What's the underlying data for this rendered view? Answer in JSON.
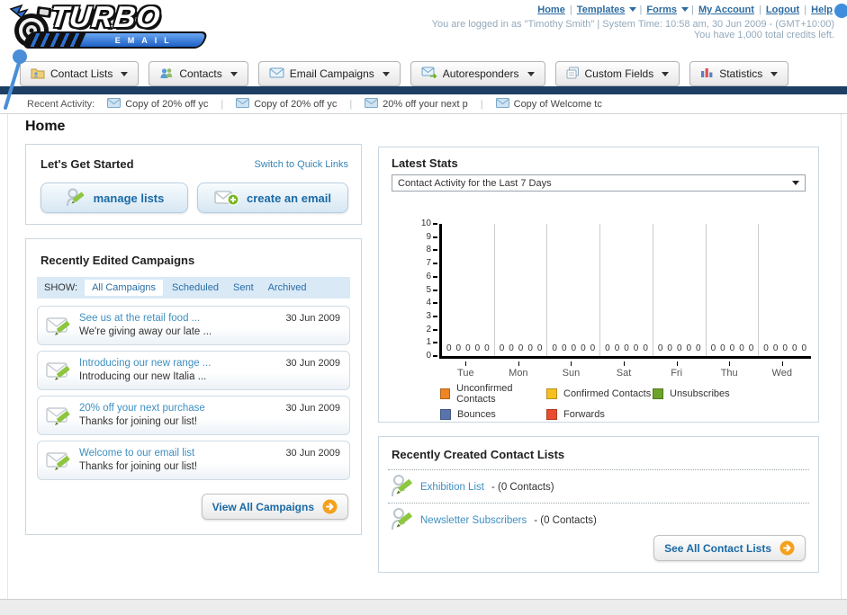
{
  "logo": {
    "title": "TURBO",
    "subtitle": "EMAIL"
  },
  "header": {
    "links": [
      {
        "label": "Home",
        "dropdown": false
      },
      {
        "label": "Templates",
        "dropdown": true
      },
      {
        "label": "Forms",
        "dropdown": true
      },
      {
        "label": "My Account",
        "dropdown": false
      },
      {
        "label": "Logout",
        "dropdown": false
      },
      {
        "label": "Help",
        "dropdown": false
      }
    ],
    "status_line1": "You are logged in as \"Timothy Smith\" | System Time: 10:58 am, 30 Jun 2009 - (GMT+10:00)",
    "status_line2": "You have 1,000 total credits left."
  },
  "nav_tabs": [
    {
      "label": "Contact Lists",
      "icon": "contact-lists-icon"
    },
    {
      "label": "Contacts",
      "icon": "contacts-icon"
    },
    {
      "label": "Email Campaigns",
      "icon": "email-campaigns-icon"
    },
    {
      "label": "Autoresponders",
      "icon": "autoresponders-icon"
    },
    {
      "label": "Custom Fields",
      "icon": "custom-fields-icon"
    },
    {
      "label": "Statistics",
      "icon": "statistics-icon"
    }
  ],
  "recent_activity": {
    "label": "Recent Activity:",
    "items": [
      "Copy of 20% off yc",
      "Copy of 20% off yc",
      "20% off your next p",
      "Copy of Welcome tc"
    ]
  },
  "page_title": "Home",
  "get_started": {
    "title": "Let's Get Started",
    "switch_link": "Switch to Quick Links",
    "buttons": [
      {
        "label": "manage lists",
        "icon": "person-pencil-icon"
      },
      {
        "label": "create an email",
        "icon": "envelope-plus-icon"
      }
    ]
  },
  "campaigns": {
    "title": "Recently Edited Campaigns",
    "show_label": "SHOW:",
    "filters": [
      "All Campaigns",
      "Scheduled",
      "Sent",
      "Archived"
    ],
    "active_filter": "All Campaigns",
    "items": [
      {
        "title": "See us at the retail food ...",
        "subtitle": "We're giving away our late ...",
        "date": "30 Jun 2009"
      },
      {
        "title": "Introducing our new range ...",
        "subtitle": "Introducing our new Italia ...",
        "date": "30 Jun 2009"
      },
      {
        "title": "20% off your next purchase",
        "subtitle": "Thanks for joining our list!",
        "date": "30 Jun 2009"
      },
      {
        "title": "Welcome to our email list",
        "subtitle": "Thanks for joining our list!",
        "date": "30 Jun 2009"
      }
    ],
    "view_all_label": "View All Campaigns"
  },
  "latest_stats": {
    "title": "Latest Stats",
    "dropdown_value": "Contact Activity for the Last 7 Days"
  },
  "chart_data": {
    "type": "bar",
    "title": "Contact Activity for the Last 7 Days",
    "categories": [
      "Tue",
      "Mon",
      "Sun",
      "Sat",
      "Fri",
      "Thu",
      "Wed"
    ],
    "series": [
      {
        "name": "Unconfirmed Contacts",
        "color": "#f08524",
        "values": [
          0,
          0,
          0,
          0,
          0,
          0,
          0
        ]
      },
      {
        "name": "Confirmed Contacts",
        "color": "#f6c020",
        "values": [
          0,
          0,
          0,
          0,
          0,
          0,
          0
        ]
      },
      {
        "name": "Unsubscribes",
        "color": "#6ca32a",
        "values": [
          0,
          0,
          0,
          0,
          0,
          0,
          0
        ]
      },
      {
        "name": "Bounces",
        "color": "#5974ad",
        "values": [
          0,
          0,
          0,
          0,
          0,
          0,
          0
        ]
      },
      {
        "name": "Forwards",
        "color": "#e84e2d",
        "values": [
          0,
          0,
          0,
          0,
          0,
          0,
          0
        ]
      }
    ],
    "xlabel": "",
    "ylabel": "",
    "ylim": [
      0,
      10
    ],
    "yticks": [
      0,
      1,
      2,
      3,
      4,
      5,
      6,
      7,
      8,
      9,
      10
    ],
    "grid": "vertical-day-separators",
    "legend_position": "bottom",
    "data_labels_shown": "0"
  },
  "contact_lists": {
    "title": "Recently Created Contact Lists",
    "items": [
      {
        "name": "Exhibition List",
        "detail": "- (0 Contacts)"
      },
      {
        "name": "Newsletter Subscribers",
        "detail": "- (0 Contacts)"
      }
    ],
    "see_all_label": "See All Contact Lists"
  }
}
